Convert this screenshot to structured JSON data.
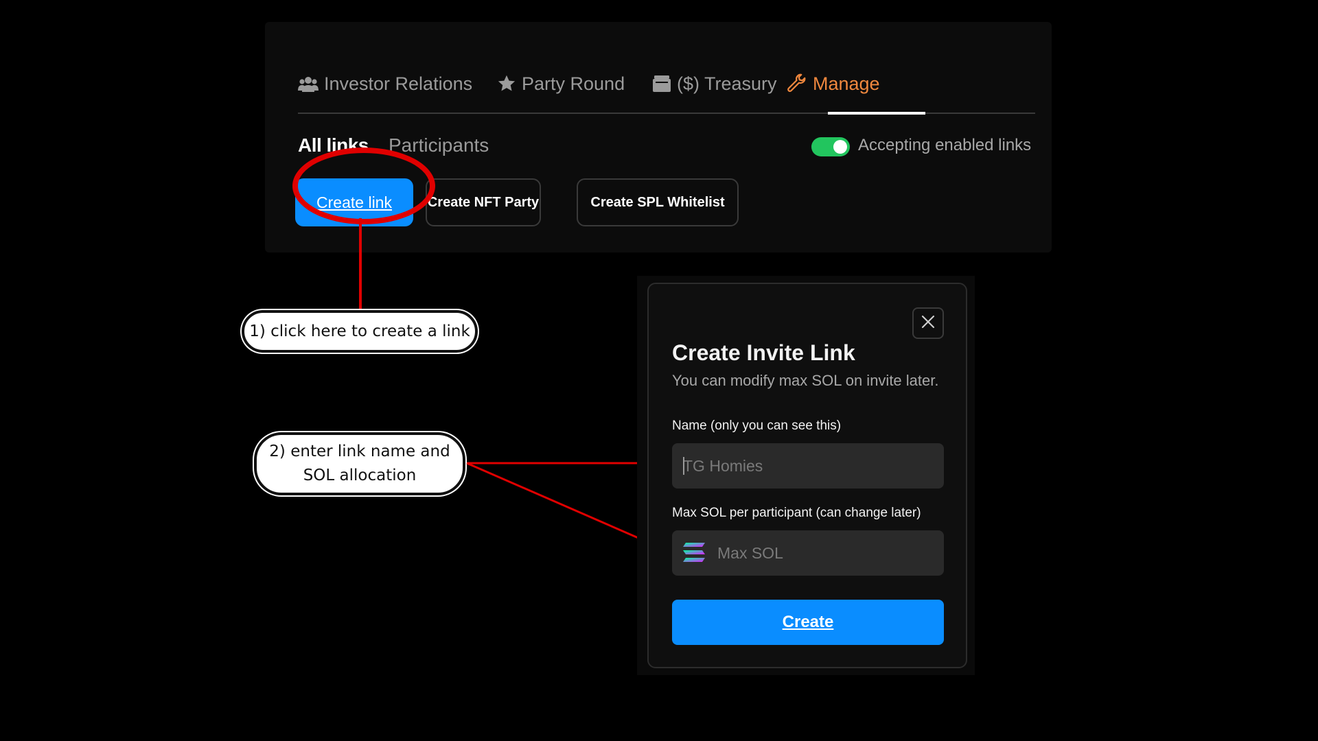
{
  "tabs": [
    {
      "label": "Investor Relations",
      "icon": "users-icon",
      "active": false
    },
    {
      "label": "Party Round",
      "icon": "star-icon",
      "active": false
    },
    {
      "label": "($) Treasury",
      "icon": "wallet-icon",
      "active": false
    },
    {
      "label": "Manage",
      "icon": "wrench-icon",
      "active": true
    }
  ],
  "subtabs": {
    "all_links": "All links",
    "participants": "Participants"
  },
  "toggle": {
    "label": "Accepting enabled links",
    "on": true,
    "color": "#22c55e"
  },
  "actions": {
    "create_link": "Create link",
    "create_nft_party": "Create NFT Party",
    "create_spl_whitelist": "Create SPL Whitelist"
  },
  "callouts": {
    "step1": "1) click here to create a link",
    "step2_line1": "2) enter link name and",
    "step2_line2": "SOL allocation"
  },
  "modal": {
    "title": "Create Invite Link",
    "subtitle": "You can modify max SOL on invite later.",
    "name_label": "Name (only you can see this)",
    "name_placeholder": "TG Homies",
    "max_label": "Max SOL per participant (can change later)",
    "max_placeholder": "Max SOL",
    "create_button": "Create"
  },
  "colors": {
    "accent": "#0a8dff",
    "active_tab": "#f0883e",
    "annotation_red": "#e00000"
  }
}
